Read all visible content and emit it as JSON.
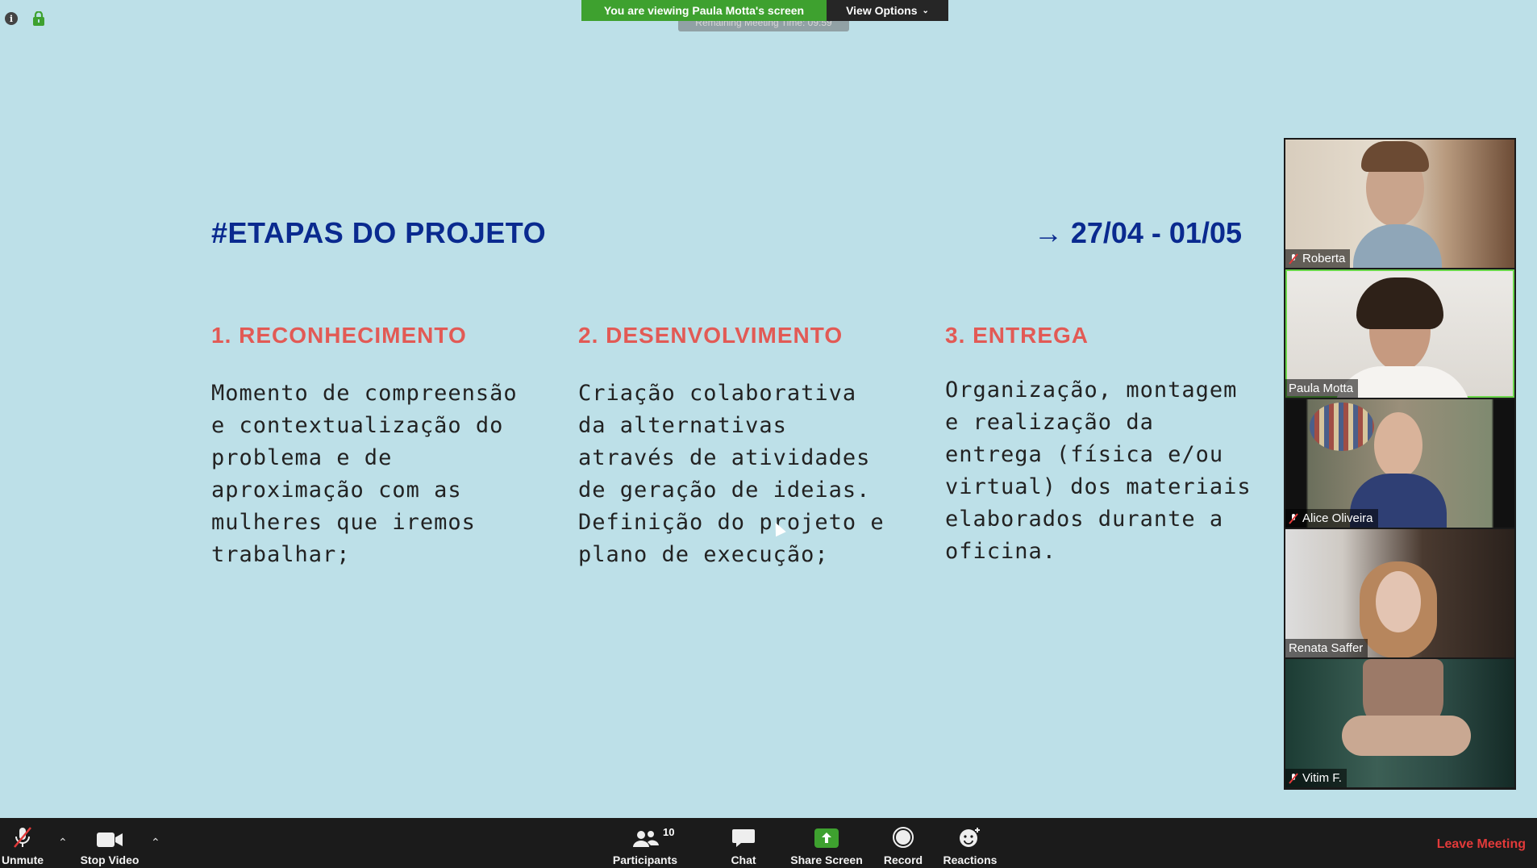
{
  "banner": {
    "viewing_text": "You are viewing Paula Motta's screen",
    "view_options_label": "View Options",
    "remaining_text": "Remaining Meeting Time: 09:59"
  },
  "slide": {
    "title": "#ETAPAS DO PROJETO",
    "dates": "→ 27/04 - 01/05",
    "columns": [
      {
        "heading": "1. RECONHECIMENTO",
        "body": "Momento de compreensão\ne contextualização do\nproblema e de\naproximação com as\nmulheres que iremos\ntrabalhar;"
      },
      {
        "heading": "2. DESENVOLVIMENTO",
        "body": "Criação colaborativa\nda alternativas\natravés de atividades\nde geração de ideias.\nDefinição do projeto e\nplano de execução;"
      },
      {
        "heading": "3. ENTREGA",
        "body": "Organização, montagem\ne realização da\nentrega (física e/ou\nvirtual) dos materiais\nelaborados durante a\noficina."
      }
    ],
    "colors": {
      "title": "#0a2a8f",
      "heading": "#e25a55",
      "background": "#bde0e8"
    }
  },
  "participants": [
    {
      "name": "Roberta",
      "muted": true
    },
    {
      "name": "Paula Motta",
      "muted": false,
      "active_speaker": true
    },
    {
      "name": "Alice Oliveira",
      "muted": true
    },
    {
      "name": "Renata Saffer",
      "muted": false
    },
    {
      "name": "Vitim F.",
      "muted": true
    }
  ],
  "toolbar": {
    "unmute_label": "Unmute",
    "stop_video_label": "Stop Video",
    "participants_label": "Participants",
    "participants_count": "10",
    "chat_label": "Chat",
    "share_screen_label": "Share Screen",
    "record_label": "Record",
    "reactions_label": "Reactions",
    "leave_label": "Leave Meeting"
  }
}
